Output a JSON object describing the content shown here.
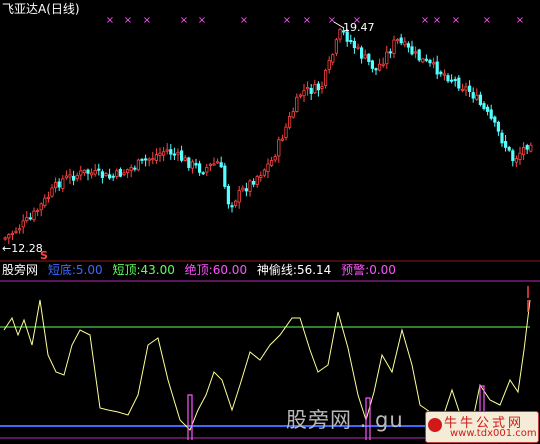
{
  "header": {
    "title": "飞亚达A(日线)"
  },
  "price_chart": {
    "high_label": "19.47",
    "low_label": "←12.28",
    "signal_marker": "S",
    "colors": {
      "up": "#ff4444",
      "down": "#54ffff",
      "marker": "#ff55ff",
      "text": "#ffffff"
    }
  },
  "indicator": {
    "name": "股旁网",
    "items": [
      {
        "label": "短底:",
        "value": "5.00",
        "color": "#3a6aff"
      },
      {
        "label": "短顶:",
        "value": "43.00",
        "color": "#60ff60"
      },
      {
        "label": "绝顶:",
        "value": "60.00",
        "color": "#ff55ff"
      },
      {
        "label": "神偷线:",
        "value": "56.14",
        "color": "#ffffff"
      },
      {
        "label": "预警:",
        "value": "0.00",
        "color": "#ff55ff"
      }
    ]
  },
  "watermark": {
    "text": "股旁网 . gu",
    "stamp_title": "牛牛公式网",
    "stamp_url": "www.tdx001.com"
  }
}
